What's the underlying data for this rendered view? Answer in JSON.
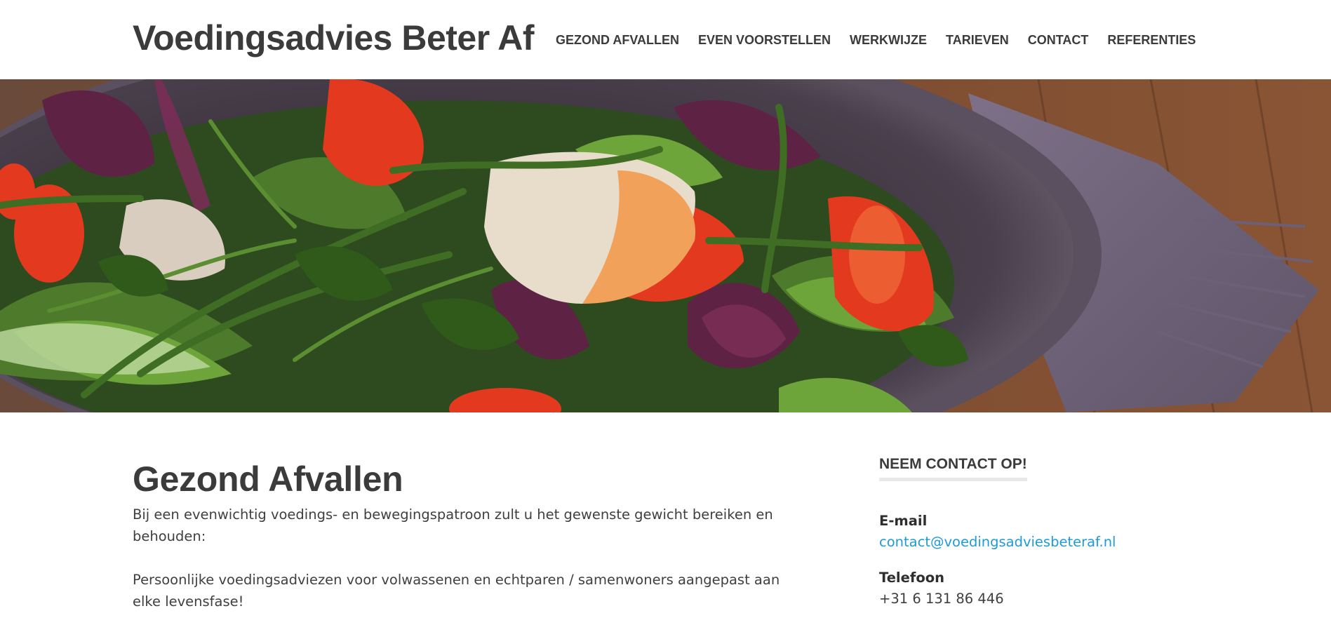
{
  "site": {
    "title": "Voedingsadvies Beter Af"
  },
  "nav": {
    "items": [
      {
        "label": "GEZOND AFVALLEN"
      },
      {
        "label": "EVEN VOORSTELLEN"
      },
      {
        "label": "WERKWIJZE"
      },
      {
        "label": "TARIEVEN"
      },
      {
        "label": "CONTACT"
      },
      {
        "label": "REFERENTIES"
      }
    ]
  },
  "main": {
    "title": "Gezond Afvallen",
    "paragraphs": [
      "Bij een evenwichtig voedings- en bewegingspatroon zult u het gewenste gewicht bereiken en behouden:",
      "Persoonlijke voedingsadviezen voor volwassenen en echtparen / samenwoners aangepast aan elke levensfase!"
    ]
  },
  "sidebar": {
    "widget_title": "NEEM CONTACT OP!",
    "email": {
      "label": "E-mail",
      "value": "contact@voedingsadviesbeteraf.nl"
    },
    "phone": {
      "label": "Telefoon",
      "value": "+31 6 131 86 446"
    }
  },
  "colors": {
    "text": "#3b3b3b",
    "link": "#1e9bd7",
    "background": "#ffffff",
    "widget_underline": "#e9e9e9"
  },
  "hero_image": {
    "description_icon": "salad-photo"
  }
}
